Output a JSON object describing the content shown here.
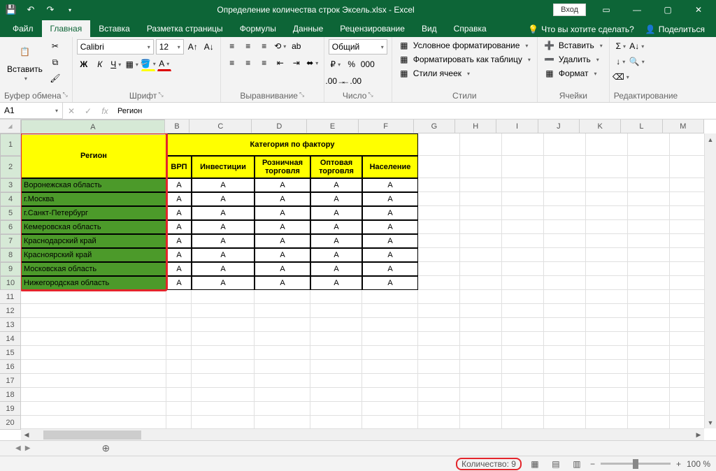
{
  "title": "Определение количества строк Эксель.xlsx  -  Excel",
  "login": "Вход",
  "tabs": {
    "file": "Файл",
    "home": "Главная",
    "insert": "Вставка",
    "layout": "Разметка страницы",
    "formulas": "Формулы",
    "data": "Данные",
    "review": "Рецензирование",
    "view": "Вид",
    "help": "Справка"
  },
  "tellme": "Что вы хотите сделать?",
  "share": "Поделиться",
  "groups": {
    "clipboard": "Буфер обмена",
    "font": "Шрифт",
    "align": "Выравнивание",
    "number": "Число",
    "styles": "Стили",
    "cells": "Ячейки",
    "editing": "Редактирование"
  },
  "paste": "Вставить",
  "font": {
    "name": "Calibri",
    "size": "12"
  },
  "numfmt": "Общий",
  "condfmt": "Условное форматирование",
  "fmttable": "Форматировать как таблицу",
  "cellstyles": "Стили ячеек",
  "insertBtn": "Вставить",
  "deleteBtn": "Удалить",
  "formatBtn": "Формат",
  "namebox": "A1",
  "formula": "Регион",
  "colHeaders": {
    "A": "A",
    "B": "B",
    "C": "C",
    "D": "D",
    "E": "E",
    "F": "F",
    "G": "G",
    "H": "H",
    "I": "I",
    "J": "J",
    "K": "K",
    "L": "L",
    "M": "M"
  },
  "cat": "Категория по фактору",
  "hdr": {
    "region": "Регион",
    "vrp": "ВРП",
    "inv": "Инвестиции",
    "retail": "Розничная торговля",
    "whole": "Оптовая торговля",
    "pop": "Население"
  },
  "rows": [
    "Воронежская область",
    "г.Москва",
    "г.Санкт-Петербург",
    "Кемеровская область",
    "Краснодарский край",
    "Красноярский край",
    "Московская область",
    "Нижегородская область"
  ],
  "val": "A",
  "count": "Количество: 9",
  "zoom": "100 %",
  "colW": {
    "A": 208,
    "B": 36,
    "C": 90,
    "D": 80,
    "E": 74,
    "F": 80,
    "def": 60
  }
}
